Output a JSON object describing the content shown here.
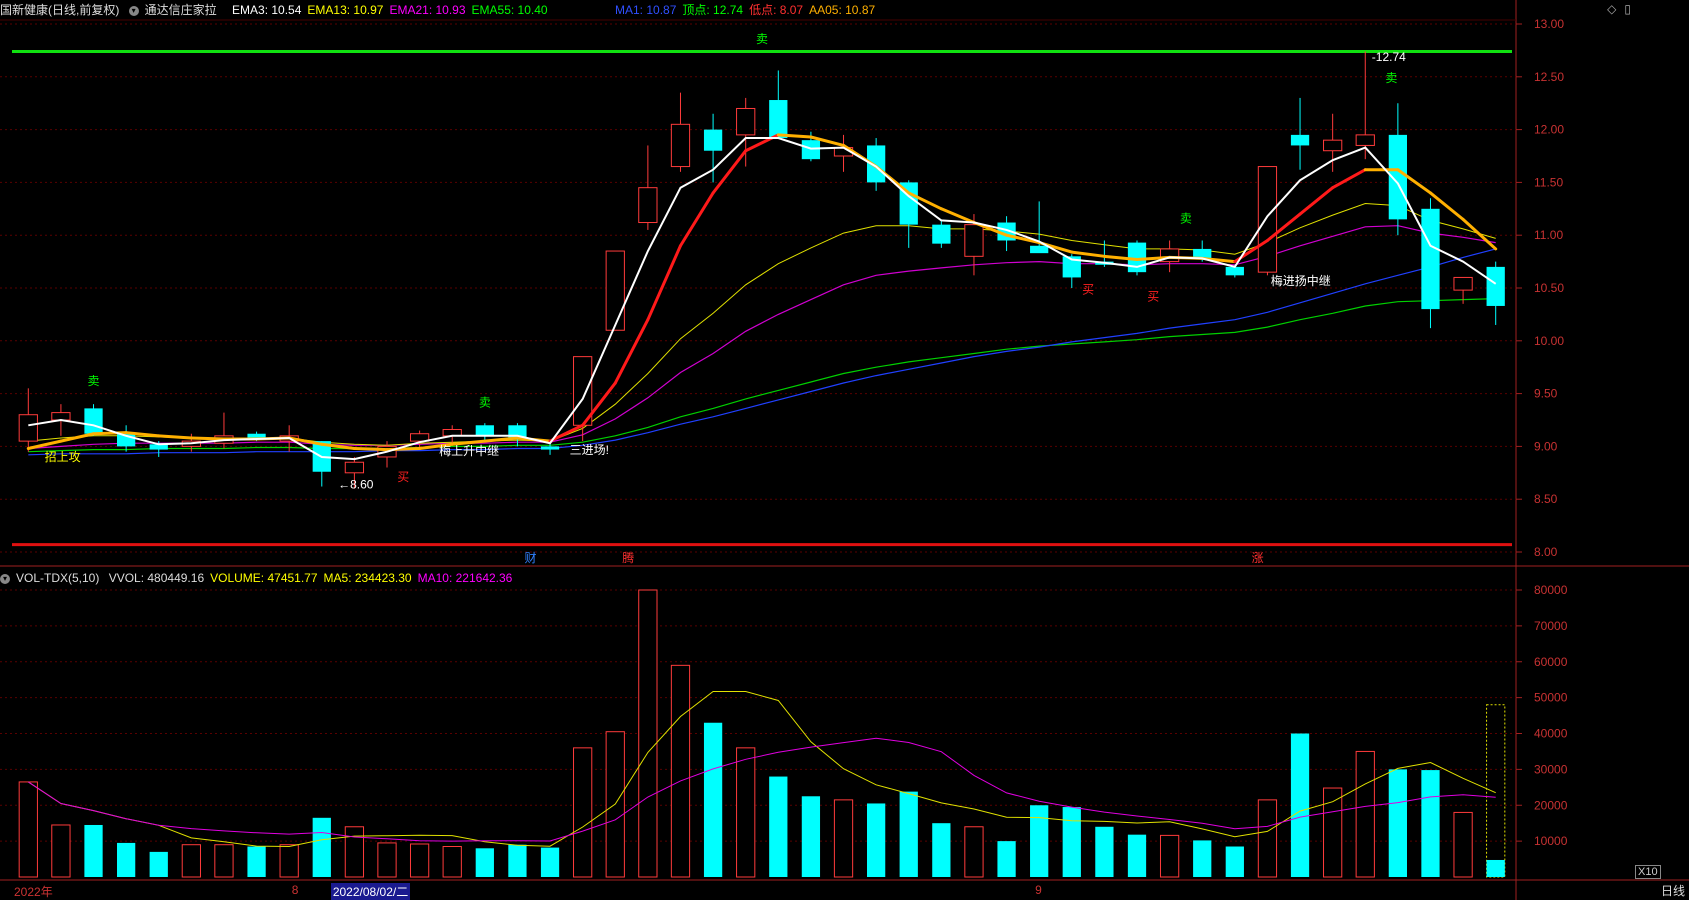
{
  "header": {
    "title": "国新健康(日线,前复权)",
    "indicator_name": "通达信庄家拉",
    "items": [
      {
        "text": "EMA3: 10.54",
        "color": "#ffffff"
      },
      {
        "text": "EMA13: 10.97",
        "color": "#ffff00"
      },
      {
        "text": "EMA21: 10.93",
        "color": "#ff00ff"
      },
      {
        "text": "EMA55: 10.40",
        "color": "#00ff00"
      }
    ],
    "items2": [
      {
        "text": "MA1: 10.87",
        "color": "#3050ff"
      },
      {
        "text": "顶点: 12.74",
        "color": "#00ff00"
      },
      {
        "text": "低点: 8.07",
        "color": "#ff3030"
      },
      {
        "text": "AA05: 10.87",
        "color": "#ffb000"
      }
    ]
  },
  "volume_header": {
    "name": "VOL-TDX(5,10)",
    "items": [
      {
        "text": "VVOL: 480449.16",
        "color": "#dddddd"
      },
      {
        "text": "VOLUME: 47451.77",
        "color": "#ffff00"
      },
      {
        "text": "MA5: 234423.30",
        "color": "#ffff00"
      },
      {
        "text": "MA10: 221642.36",
        "color": "#ff00ff"
      }
    ]
  },
  "x_labels": [
    {
      "text": "2022年",
      "idx": 0
    },
    {
      "text": "8",
      "idx": 8.2
    },
    {
      "text": "2022/08/02/二",
      "idx": 9.4
    },
    {
      "text": "9",
      "idx": 31
    }
  ],
  "timeframe": "日线",
  "zoom": "X10",
  "chart_data": {
    "type": "candlestick",
    "price_axis": {
      "min": 8.0,
      "max": 13.0,
      "ticks": [
        "13.00",
        "12.50",
        "12.00",
        "11.50",
        "11.00",
        "10.50",
        "10.00",
        "9.50",
        "9.00",
        "8.50",
        "8.00"
      ]
    },
    "volume_axis": {
      "min": 0,
      "max": 80000,
      "ticks": [
        "80000",
        "70000",
        "60000",
        "50000",
        "40000",
        "30000",
        "20000",
        "10000"
      ]
    },
    "candles": [
      {
        "o": 9.05,
        "h": 9.55,
        "l": 8.95,
        "c": 9.3
      },
      {
        "o": 9.25,
        "h": 9.4,
        "l": 9.1,
        "c": 9.32
      },
      {
        "o": 9.36,
        "h": 9.4,
        "l": 9.1,
        "c": 9.12
      },
      {
        "o": 9.12,
        "h": 9.2,
        "l": 8.95,
        "c": 9.0
      },
      {
        "o": 9.02,
        "h": 9.05,
        "l": 8.9,
        "c": 8.97
      },
      {
        "o": 9.0,
        "h": 9.12,
        "l": 8.95,
        "c": 9.05
      },
      {
        "o": 9.03,
        "h": 9.32,
        "l": 8.98,
        "c": 9.1
      },
      {
        "o": 9.12,
        "h": 9.14,
        "l": 9.05,
        "c": 9.08
      },
      {
        "o": 9.05,
        "h": 9.2,
        "l": 8.95,
        "c": 9.1
      },
      {
        "o": 9.05,
        "h": 9.05,
        "l": 8.62,
        "c": 8.76
      },
      {
        "o": 8.75,
        "h": 8.9,
        "l": 8.6,
        "c": 8.85
      },
      {
        "o": 8.9,
        "h": 9.05,
        "l": 8.8,
        "c": 9.0
      },
      {
        "o": 9.05,
        "h": 9.15,
        "l": 8.98,
        "c": 9.12
      },
      {
        "o": 9.1,
        "h": 9.2,
        "l": 9.02,
        "c": 9.16
      },
      {
        "o": 9.2,
        "h": 9.22,
        "l": 9.05,
        "c": 9.1
      },
      {
        "o": 9.2,
        "h": 9.22,
        "l": 9.0,
        "c": 9.08
      },
      {
        "o": 9.0,
        "h": 9.05,
        "l": 8.92,
        "c": 8.97
      },
      {
        "o": 9.2,
        "h": 9.85,
        "l": 9.05,
        "c": 9.85
      },
      {
        "o": 10.1,
        "h": 10.85,
        "l": 10.1,
        "c": 10.85
      },
      {
        "o": 11.12,
        "h": 11.85,
        "l": 11.05,
        "c": 11.45
      },
      {
        "o": 11.65,
        "h": 12.35,
        "l": 11.6,
        "c": 12.05
      },
      {
        "o": 12.0,
        "h": 12.15,
        "l": 11.5,
        "c": 11.8
      },
      {
        "o": 11.95,
        "h": 12.3,
        "l": 11.65,
        "c": 12.2
      },
      {
        "o": 12.28,
        "h": 12.56,
        "l": 11.92,
        "c": 11.92
      },
      {
        "o": 11.9,
        "h": 11.98,
        "l": 11.7,
        "c": 11.72
      },
      {
        "o": 11.75,
        "h": 11.95,
        "l": 11.6,
        "c": 11.83
      },
      {
        "o": 11.85,
        "h": 11.92,
        "l": 11.42,
        "c": 11.5
      },
      {
        "o": 11.5,
        "h": 11.52,
        "l": 10.88,
        "c": 11.1
      },
      {
        "o": 11.1,
        "h": 11.15,
        "l": 10.88,
        "c": 10.92
      },
      {
        "o": 10.8,
        "h": 11.2,
        "l": 10.62,
        "c": 11.1
      },
      {
        "o": 11.12,
        "h": 11.18,
        "l": 10.85,
        "c": 10.95
      },
      {
        "o": 10.9,
        "h": 11.32,
        "l": 10.85,
        "c": 10.83
      },
      {
        "o": 10.8,
        "h": 10.82,
        "l": 10.5,
        "c": 10.6
      },
      {
        "o": 10.75,
        "h": 10.95,
        "l": 10.7,
        "c": 10.72
      },
      {
        "o": 10.93,
        "h": 10.95,
        "l": 10.62,
        "c": 10.65
      },
      {
        "o": 10.75,
        "h": 10.95,
        "l": 10.65,
        "c": 10.87
      },
      {
        "o": 10.87,
        "h": 10.95,
        "l": 10.75,
        "c": 10.78
      },
      {
        "o": 10.7,
        "h": 10.72,
        "l": 10.6,
        "c": 10.62
      },
      {
        "o": 10.65,
        "h": 11.65,
        "l": 10.62,
        "c": 11.65
      },
      {
        "o": 11.95,
        "h": 12.3,
        "l": 11.62,
        "c": 11.85
      },
      {
        "o": 11.8,
        "h": 12.15,
        "l": 11.6,
        "c": 11.9
      },
      {
        "o": 11.85,
        "h": 12.74,
        "l": 11.72,
        "c": 11.95
      },
      {
        "o": 11.95,
        "h": 12.25,
        "l": 11.0,
        "c": 11.15
      },
      {
        "o": 11.25,
        "h": 11.35,
        "l": 10.12,
        "c": 10.3
      },
      {
        "o": 10.48,
        "h": 10.6,
        "l": 10.35,
        "c": 10.6
      },
      {
        "o": 10.7,
        "h": 10.75,
        "l": 10.15,
        "c": 10.33
      }
    ],
    "volumes": [
      26500,
      14500,
      14500,
      9500,
      7000,
      9000,
      9000,
      8500,
      9000,
      16500,
      14000,
      9500,
      9200,
      8500,
      8000,
      9000,
      8200,
      36000,
      40500,
      80000,
      59000,
      43000,
      36000,
      28000,
      22500,
      21500,
      20500,
      23800,
      15000,
      14000,
      10000,
      20000,
      19500,
      14000,
      11800,
      11600,
      10200,
      8500,
      21500,
      40000,
      24800,
      35000,
      30000,
      29800,
      18000,
      4745
    ],
    "lines": {
      "EMA3": [
        9.2,
        9.25,
        9.2,
        9.1,
        9.02,
        9.03,
        9.06,
        9.07,
        9.08,
        8.9,
        8.88,
        8.95,
        9.04,
        9.1,
        9.1,
        9.1,
        9.03,
        9.45,
        10.15,
        10.85,
        11.45,
        11.62,
        11.92,
        11.92,
        11.82,
        11.83,
        11.65,
        11.37,
        11.14,
        11.12,
        11.05,
        10.94,
        10.77,
        10.74,
        10.7,
        10.79,
        10.78,
        10.7,
        11.18,
        11.52,
        11.71,
        11.83,
        11.49,
        10.9,
        10.75,
        10.54
      ],
      "EMA13": [
        9.05,
        9.08,
        9.1,
        9.1,
        9.09,
        9.08,
        9.08,
        9.08,
        9.08,
        9.04,
        9.02,
        9.01,
        9.03,
        9.04,
        9.05,
        9.06,
        9.05,
        9.17,
        9.4,
        9.69,
        10.02,
        10.26,
        10.53,
        10.73,
        10.88,
        11.02,
        11.09,
        11.09,
        11.06,
        11.06,
        11.04,
        11.01,
        10.95,
        10.91,
        10.87,
        10.87,
        10.86,
        10.82,
        10.93,
        11.07,
        11.19,
        11.3,
        11.28,
        11.14,
        11.06,
        10.97
      ],
      "EMA21": [
        8.98,
        9.0,
        9.02,
        9.03,
        9.03,
        9.03,
        9.03,
        9.04,
        9.04,
        9.02,
        9.01,
        9.01,
        9.02,
        9.03,
        9.03,
        9.04,
        9.04,
        9.11,
        9.26,
        9.46,
        9.7,
        9.88,
        10.09,
        10.25,
        10.39,
        10.53,
        10.62,
        10.66,
        10.69,
        10.72,
        10.74,
        10.75,
        10.73,
        10.73,
        10.72,
        10.73,
        10.73,
        10.72,
        10.8,
        10.9,
        10.99,
        11.08,
        11.09,
        11.02,
        10.98,
        10.93
      ],
      "EMA55": [
        8.95,
        8.96,
        8.97,
        8.97,
        8.98,
        8.98,
        8.98,
        8.99,
        8.99,
        8.98,
        8.98,
        8.98,
        8.99,
        9.0,
        9.0,
        9.01,
        9.01,
        9.04,
        9.1,
        9.18,
        9.28,
        9.36,
        9.45,
        9.53,
        9.61,
        9.69,
        9.75,
        9.8,
        9.84,
        9.88,
        9.92,
        9.95,
        9.97,
        9.99,
        10.01,
        10.04,
        10.06,
        10.08,
        10.13,
        10.2,
        10.26,
        10.33,
        10.37,
        10.38,
        10.39,
        10.4
      ],
      "MA1": [
        8.92,
        8.93,
        8.93,
        8.93,
        8.94,
        8.94,
        8.94,
        8.95,
        8.95,
        8.95,
        8.95,
        8.96,
        8.96,
        8.97,
        8.97,
        8.98,
        8.98,
        9.01,
        9.06,
        9.13,
        9.21,
        9.28,
        9.36,
        9.44,
        9.52,
        9.6,
        9.67,
        9.73,
        9.79,
        9.85,
        9.9,
        9.94,
        9.99,
        10.03,
        10.07,
        10.12,
        10.16,
        10.2,
        10.27,
        10.36,
        10.45,
        10.54,
        10.62,
        10.7,
        10.79,
        10.87
      ],
      "AA05": [
        8.98,
        9.05,
        9.12,
        9.13,
        9.1,
        9.08,
        9.07,
        9.07,
        9.08,
        9.02,
        8.98,
        8.97,
        8.98,
        9.02,
        9.05,
        9.08,
        9.05,
        9.2,
        9.6,
        10.2,
        10.9,
        11.4,
        11.8,
        11.95,
        11.93,
        11.85,
        11.65,
        11.4,
        11.25,
        11.12,
        11.0,
        10.93,
        10.84,
        10.8,
        10.77,
        10.79,
        10.78,
        10.75,
        10.95,
        11.2,
        11.45,
        11.62,
        11.62,
        11.4,
        11.15,
        10.87
      ]
    },
    "top_line": 12.74,
    "bottom_line": 8.07,
    "annotations": [
      {
        "text": "卖",
        "idx": 2,
        "price": 9.58,
        "color": "#00ff00"
      },
      {
        "text": "卖",
        "idx": 14,
        "price": 9.38,
        "color": "#00ff00"
      },
      {
        "text": "卖",
        "idx": 22.5,
        "price": 12.82,
        "color": "#00ff00"
      },
      {
        "text": "卖",
        "idx": 35.5,
        "price": 11.12,
        "color": "#00ff00"
      },
      {
        "text": "卖",
        "idx": 41.8,
        "price": 12.45,
        "color": "#00ff00"
      },
      {
        "text": "买",
        "idx": 11.5,
        "price": 8.67,
        "color": "#ff2020"
      },
      {
        "text": "买",
        "idx": 32.5,
        "price": 10.45,
        "color": "#ff2020"
      },
      {
        "text": "买",
        "idx": 34.5,
        "price": 10.38,
        "color": "#ff2020"
      },
      {
        "text": "←8.60",
        "idx": 9.5,
        "price": 8.6,
        "color": "#ffffff"
      },
      {
        "text": "-12.74",
        "idx": 41.2,
        "price": 12.65,
        "color": "#ffffff"
      },
      {
        "text": "三进场!",
        "idx": 16.6,
        "price": 8.93,
        "color": "#ffffff"
      },
      {
        "text": "梅上升中继",
        "idx": 12.6,
        "price": 8.92,
        "color": "#ffffff"
      },
      {
        "text": "梅进扬中继",
        "idx": 38.1,
        "price": 10.53,
        "color": "#ffffff"
      },
      {
        "text": "招上攻",
        "idx": 0.5,
        "price": 8.86,
        "color": "#ffff00"
      }
    ],
    "bottom_tags": [
      {
        "text": "财",
        "idx": 15.4,
        "color": "#3080ff"
      },
      {
        "text": "腾",
        "idx": 18.4,
        "color": "#ff3030"
      },
      {
        "text": "涨",
        "idx": 37.7,
        "color": "#ff3030"
      }
    ]
  }
}
